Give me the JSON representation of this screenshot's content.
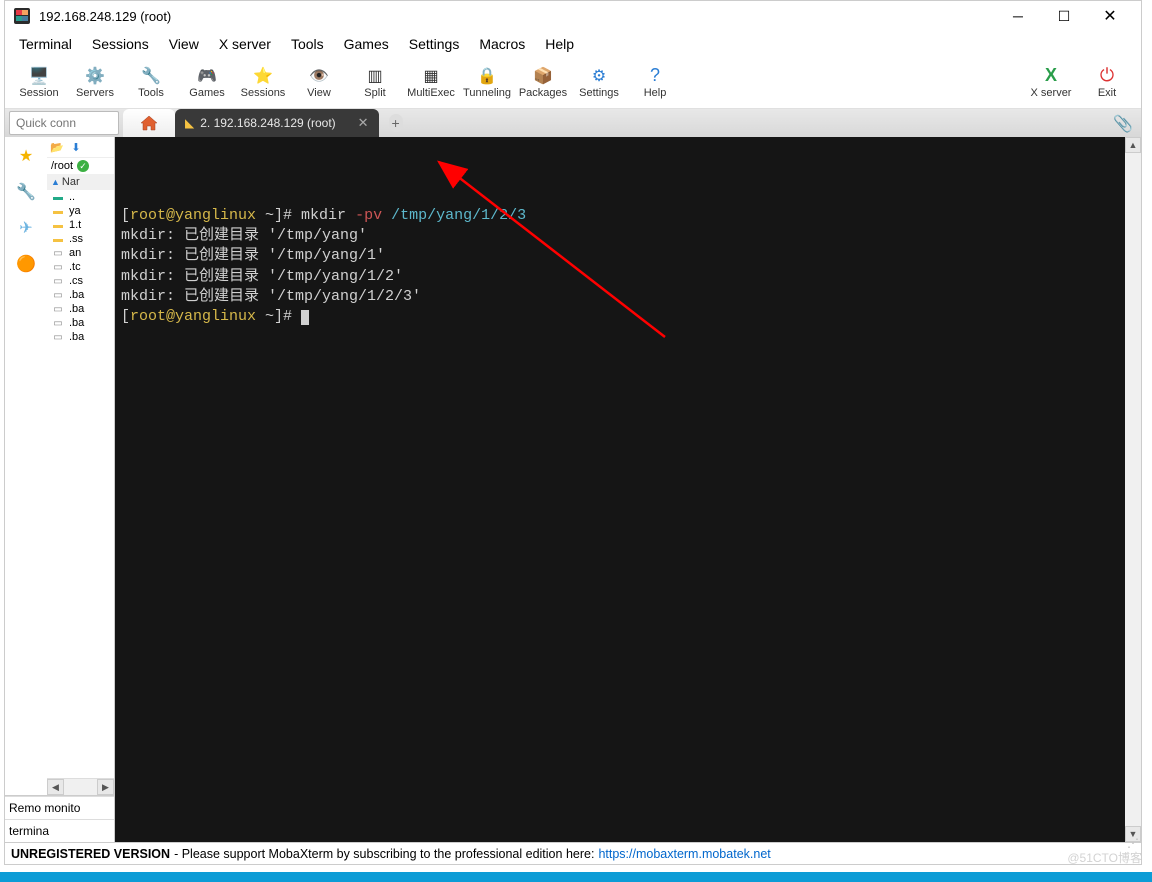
{
  "title": "192.168.248.129 (root)",
  "menus": [
    "Terminal",
    "Sessions",
    "View",
    "X server",
    "Tools",
    "Games",
    "Settings",
    "Macros",
    "Help"
  ],
  "toolbar": [
    {
      "label": "Session",
      "icon": "🖥️"
    },
    {
      "label": "Servers",
      "icon": "⚙️"
    },
    {
      "label": "Tools",
      "icon": "🔧"
    },
    {
      "label": "Games",
      "icon": "🎮"
    },
    {
      "label": "Sessions",
      "icon": "⭐"
    },
    {
      "label": "View",
      "icon": "👁️"
    },
    {
      "label": "Split",
      "icon": "▥"
    },
    {
      "label": "MultiExec",
      "icon": "▦"
    },
    {
      "label": "Tunneling",
      "icon": "🔒"
    },
    {
      "label": "Packages",
      "icon": "📦"
    },
    {
      "label": "Settings",
      "icon": "⚙"
    },
    {
      "label": "Help",
      "icon": "❓"
    }
  ],
  "toolbar_right": [
    {
      "label": "X server",
      "icon": "X"
    },
    {
      "label": "Exit",
      "icon": "⏻"
    }
  ],
  "quick_connect_placeholder": "Quick conn",
  "tabs": {
    "active_label": "2. 192.168.248.129 (root)"
  },
  "sidebar": {
    "path": "/root",
    "header": "Nar",
    "files": [
      {
        "name": "..",
        "type": "gfolder"
      },
      {
        "name": "ya",
        "type": "folder"
      },
      {
        "name": "1.t",
        "type": "folder"
      },
      {
        "name": ".ss",
        "type": "folder"
      },
      {
        "name": "an",
        "type": "file"
      },
      {
        "name": ".tc",
        "type": "file"
      },
      {
        "name": ".cs",
        "type": "file"
      },
      {
        "name": ".ba",
        "type": "file"
      },
      {
        "name": ".ba",
        "type": "file"
      },
      {
        "name": ".ba",
        "type": "file"
      },
      {
        "name": ".ba",
        "type": "file"
      }
    ],
    "bottom_tabs": [
      "Remo monito",
      "termina"
    ]
  },
  "terminal": {
    "lines": [
      {
        "raw": "[root@yanglinux ~]# mkdir -pv /tmp/yang/1/2/3",
        "segments": [
          {
            "t": "[",
            "c": "plain"
          },
          {
            "t": "root@yanglinux",
            "c": "yellow"
          },
          {
            "t": " ~]# mkdir ",
            "c": "plain"
          },
          {
            "t": "-pv",
            "c": "red"
          },
          {
            "t": " ",
            "c": "plain"
          },
          {
            "t": "/tmp/yang/1/2/3",
            "c": "cyan"
          }
        ]
      },
      {
        "segments": [
          {
            "t": "mkdir: 已创建目录 '/tmp/yang'",
            "c": "plain"
          }
        ]
      },
      {
        "segments": [
          {
            "t": "mkdir: 已创建目录 '/tmp/yang/1'",
            "c": "plain"
          }
        ]
      },
      {
        "segments": [
          {
            "t": "mkdir: 已创建目录 '/tmp/yang/1/2'",
            "c": "plain"
          }
        ]
      },
      {
        "segments": [
          {
            "t": "mkdir: 已创建目录 '/tmp/yang/1/2/3'",
            "c": "plain"
          }
        ]
      },
      {
        "segments": [
          {
            "t": "[",
            "c": "plain"
          },
          {
            "t": "root@yanglinux",
            "c": "yellow"
          },
          {
            "t": " ~]# ",
            "c": "plain"
          }
        ],
        "cursor": true
      }
    ]
  },
  "status": {
    "bold": "UNREGISTERED VERSION",
    "text": " -  Please support MobaXterm by subscribing to the professional edition here: ",
    "link": "https://mobaxterm.mobatek.net"
  },
  "watermark": "@51CTO博客"
}
